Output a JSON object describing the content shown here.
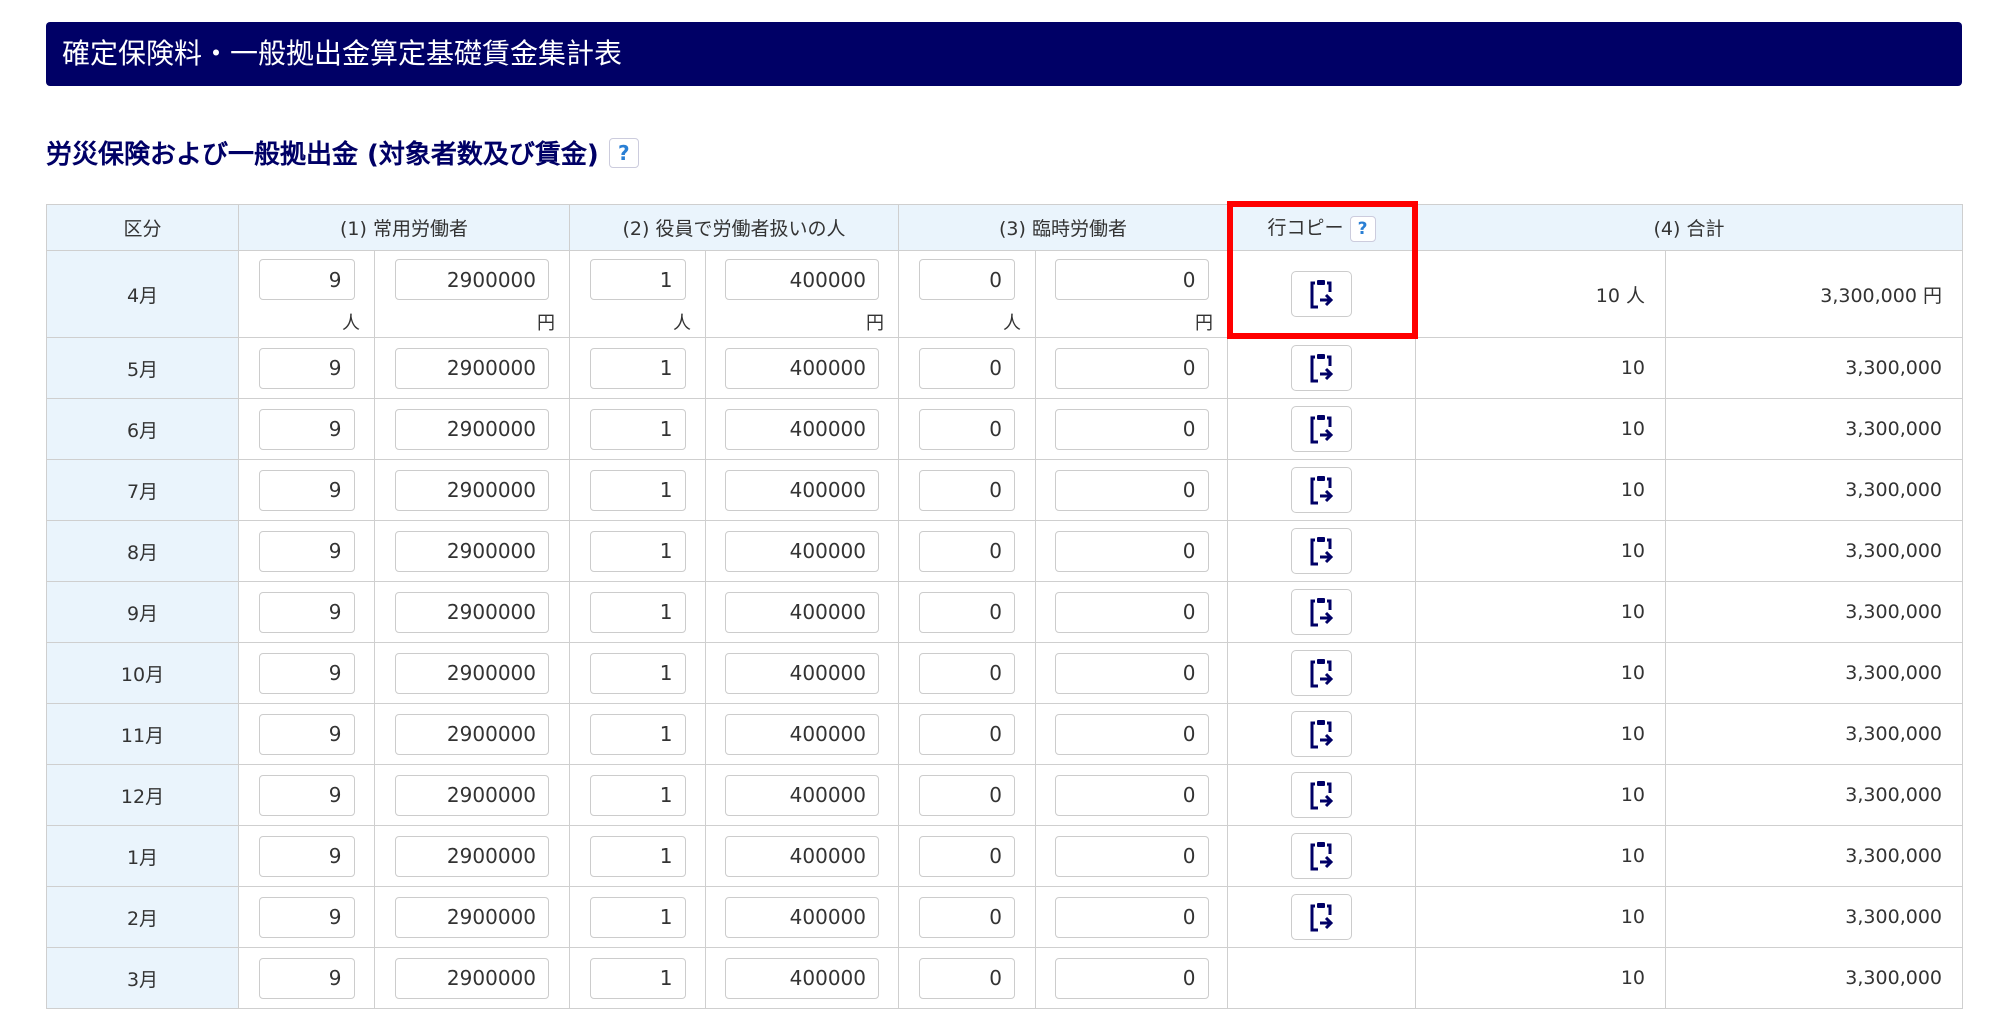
{
  "page_title": "確定保険料・一般拠出金算定基礎賃金集計表",
  "section_title": "労災保険および一般拠出金 (対象者数及び賃金)",
  "help_label": "?",
  "headers": {
    "category": "区分",
    "regular": "(1) 常用労働者",
    "officers": "(2) 役員で労働者扱いの人",
    "temporary": "(3) 臨時労働者",
    "row_copy": "行コピー",
    "total": "(4) 合計"
  },
  "units": {
    "person": "人",
    "yen": "円"
  },
  "accent_color": "#000066",
  "highlight_color": "#ff0000",
  "rows": [
    {
      "month": "4月",
      "regular_count": "9",
      "regular_wage": "2900000",
      "officer_count": "1",
      "officer_wage": "400000",
      "temp_count": "0",
      "temp_wage": "0",
      "copy": true,
      "total_count": "10 人",
      "total_wage": "3,300,000 円"
    },
    {
      "month": "5月",
      "regular_count": "9",
      "regular_wage": "2900000",
      "officer_count": "1",
      "officer_wage": "400000",
      "temp_count": "0",
      "temp_wage": "0",
      "copy": true,
      "total_count": "10",
      "total_wage": "3,300,000"
    },
    {
      "month": "6月",
      "regular_count": "9",
      "regular_wage": "2900000",
      "officer_count": "1",
      "officer_wage": "400000",
      "temp_count": "0",
      "temp_wage": "0",
      "copy": true,
      "total_count": "10",
      "total_wage": "3,300,000"
    },
    {
      "month": "7月",
      "regular_count": "9",
      "regular_wage": "2900000",
      "officer_count": "1",
      "officer_wage": "400000",
      "temp_count": "0",
      "temp_wage": "0",
      "copy": true,
      "total_count": "10",
      "total_wage": "3,300,000"
    },
    {
      "month": "8月",
      "regular_count": "9",
      "regular_wage": "2900000",
      "officer_count": "1",
      "officer_wage": "400000",
      "temp_count": "0",
      "temp_wage": "0",
      "copy": true,
      "total_count": "10",
      "total_wage": "3,300,000"
    },
    {
      "month": "9月",
      "regular_count": "9",
      "regular_wage": "2900000",
      "officer_count": "1",
      "officer_wage": "400000",
      "temp_count": "0",
      "temp_wage": "0",
      "copy": true,
      "total_count": "10",
      "total_wage": "3,300,000"
    },
    {
      "month": "10月",
      "regular_count": "9",
      "regular_wage": "2900000",
      "officer_count": "1",
      "officer_wage": "400000",
      "temp_count": "0",
      "temp_wage": "0",
      "copy": true,
      "total_count": "10",
      "total_wage": "3,300,000"
    },
    {
      "month": "11月",
      "regular_count": "9",
      "regular_wage": "2900000",
      "officer_count": "1",
      "officer_wage": "400000",
      "temp_count": "0",
      "temp_wage": "0",
      "copy": true,
      "total_count": "10",
      "total_wage": "3,300,000"
    },
    {
      "month": "12月",
      "regular_count": "9",
      "regular_wage": "2900000",
      "officer_count": "1",
      "officer_wage": "400000",
      "temp_count": "0",
      "temp_wage": "0",
      "copy": true,
      "total_count": "10",
      "total_wage": "3,300,000"
    },
    {
      "month": "1月",
      "regular_count": "9",
      "regular_wage": "2900000",
      "officer_count": "1",
      "officer_wage": "400000",
      "temp_count": "0",
      "temp_wage": "0",
      "copy": true,
      "total_count": "10",
      "total_wage": "3,300,000"
    },
    {
      "month": "2月",
      "regular_count": "9",
      "regular_wage": "2900000",
      "officer_count": "1",
      "officer_wage": "400000",
      "temp_count": "0",
      "temp_wage": "0",
      "copy": true,
      "total_count": "10",
      "total_wage": "3,300,000"
    },
    {
      "month": "3月",
      "regular_count": "9",
      "regular_wage": "2900000",
      "officer_count": "1",
      "officer_wage": "400000",
      "temp_count": "0",
      "temp_wage": "0",
      "copy": false,
      "total_count": "10",
      "total_wage": "3,300,000"
    }
  ]
}
